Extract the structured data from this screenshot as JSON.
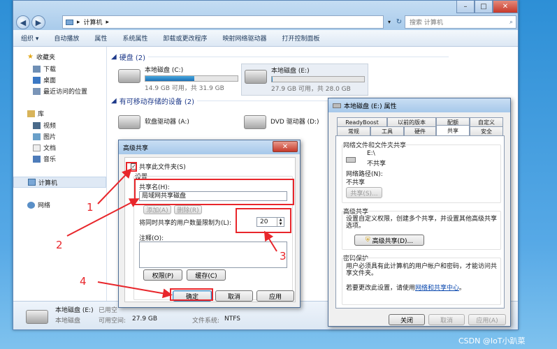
{
  "explorer": {
    "address_path": "计算机",
    "search_placeholder": "搜索 计算机",
    "toolbar": [
      "组织",
      "自动播放",
      "属性",
      "系统属性",
      "卸载或更改程序",
      "映射网络驱动器",
      "打开控制面板"
    ],
    "nav": {
      "favorites": "收藏夹",
      "favorites_items": [
        "下载",
        "桌面",
        "最近访问的位置"
      ],
      "libraries": "库",
      "library_items": [
        "视频",
        "图片",
        "文档",
        "音乐"
      ],
      "computer": "计算机",
      "network": "网络"
    },
    "groups": {
      "hard_disks": "硬盘 (2)",
      "removable": "有可移动存储的设备 (2)"
    },
    "drives": [
      {
        "name": "本地磁盘 (C:)",
        "free": "14.9 GB 可用，共 31.9 GB",
        "used_fraction": 0.53
      },
      {
        "name": "本地磁盘 (E:)",
        "free": "27.9 GB 可用，共 28.0 GB",
        "used_fraction": 0.01
      }
    ],
    "removable": [
      {
        "name": "软盘驱动器 (A:)"
      },
      {
        "name": "DVD 驱动器 (D:)"
      }
    ],
    "detail": {
      "name": "本地磁盘 (E:)",
      "used_label": "已用空",
      "type": "本地磁盘",
      "free_label": "可用空间:",
      "free_value": "27.9 GB",
      "fs_label": "文件系统:",
      "fs_value": "NTFS"
    }
  },
  "advanced_sharing": {
    "title": "高级共享",
    "share_checkbox": "共享此文件夹(S)",
    "settings_label": "设置",
    "share_name_label": "共享名(H):",
    "share_name_value": "局域网共享磁盘",
    "add_button": "添加(A)",
    "remove_button": "删除(R)",
    "limit_label": "将同时共享的用户数量限制为(L):",
    "limit_value": "20",
    "comment_label": "注释(O):",
    "permissions_button": "权限(P)",
    "cache_button": "缓存(C)",
    "ok_button": "确定",
    "cancel_button": "取消",
    "apply_button": "应用"
  },
  "properties": {
    "title": "本地磁盘 (E:) 属性",
    "tabs_row1": [
      "ReadyBoost",
      "以前的版本",
      "配额",
      "自定义"
    ],
    "tabs_row2": [
      "常规",
      "工具",
      "硬件",
      "共享",
      "安全"
    ],
    "net_share_group": "网络文件和文件夹共享",
    "drive_label": "E:\\",
    "share_state": "不共享",
    "net_path_label": "网络路径(N):",
    "net_path_value": "不共享",
    "share_button": "共享(S)...",
    "adv_group": "高级共享",
    "adv_desc": "设置自定义权限，创建多个共享，并设置其他高级共享选项。",
    "adv_button": "高级共享(D)...",
    "pwd_group": "密码保护",
    "pwd_desc": "用户必须具有此计算机的用户帐户和密码，才能访问共享文件夹。",
    "pwd_change_prefix": "若要更改此设置，请使用",
    "pwd_link": "网络和共享中心",
    "pwd_suffix": "。",
    "close_button": "关闭",
    "cancel_button": "取消",
    "apply_button": "应用(A)"
  },
  "annotations": [
    "1",
    "2",
    "3",
    "4"
  ],
  "watermark": "CSDN @IoT小趴菜",
  "colors": {
    "annotation_red": "#e8262b",
    "link_blue": "#0645ad"
  }
}
